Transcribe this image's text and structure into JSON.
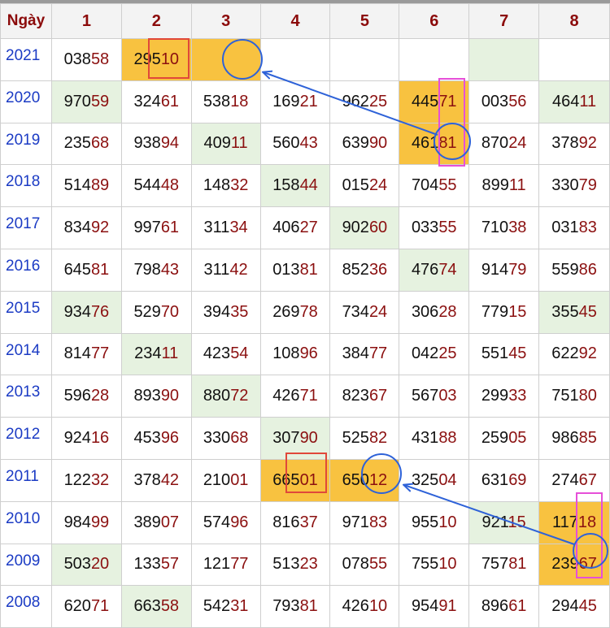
{
  "header": {
    "corner_label": "Ngày",
    "columns": [
      "1",
      "2",
      "3",
      "4",
      "5",
      "6",
      "7",
      "8"
    ]
  },
  "rows": [
    {
      "year": "2021",
      "cells": [
        {
          "head": "038",
          "tail": "58",
          "bg": ""
        },
        {
          "head": "295",
          "tail": "10",
          "bg": "y"
        },
        {
          "head": "",
          "tail": "",
          "bg": "y"
        },
        {
          "head": "",
          "tail": "",
          "bg": ""
        },
        {
          "head": "",
          "tail": "",
          "bg": ""
        },
        {
          "head": "",
          "tail": "",
          "bg": ""
        },
        {
          "head": "",
          "tail": "",
          "bg": "g"
        },
        {
          "head": "",
          "tail": "",
          "bg": ""
        }
      ]
    },
    {
      "year": "2020",
      "cells": [
        {
          "head": "970",
          "tail": "59",
          "bg": "g"
        },
        {
          "head": "324",
          "tail": "61",
          "bg": ""
        },
        {
          "head": "538",
          "tail": "18",
          "bg": ""
        },
        {
          "head": "169",
          "tail": "21",
          "bg": ""
        },
        {
          "head": "962",
          "tail": "25",
          "bg": ""
        },
        {
          "head": "445",
          "tail": "71",
          "bg": "y"
        },
        {
          "head": "003",
          "tail": "56",
          "bg": ""
        },
        {
          "head": "464",
          "tail": "11",
          "bg": "g"
        }
      ]
    },
    {
      "year": "2019",
      "cells": [
        {
          "head": "235",
          "tail": "68",
          "bg": ""
        },
        {
          "head": "938",
          "tail": "94",
          "bg": ""
        },
        {
          "head": "409",
          "tail": "11",
          "bg": "g"
        },
        {
          "head": "560",
          "tail": "43",
          "bg": ""
        },
        {
          "head": "639",
          "tail": "90",
          "bg": ""
        },
        {
          "head": "461",
          "tail": "81",
          "bg": "y"
        },
        {
          "head": "870",
          "tail": "24",
          "bg": ""
        },
        {
          "head": "378",
          "tail": "92",
          "bg": ""
        }
      ]
    },
    {
      "year": "2018",
      "cells": [
        {
          "head": "514",
          "tail": "89",
          "bg": ""
        },
        {
          "head": "544",
          "tail": "48",
          "bg": ""
        },
        {
          "head": "148",
          "tail": "32",
          "bg": ""
        },
        {
          "head": "158",
          "tail": "44",
          "bg": "g"
        },
        {
          "head": "015",
          "tail": "24",
          "bg": ""
        },
        {
          "head": "704",
          "tail": "55",
          "bg": ""
        },
        {
          "head": "899",
          "tail": "11",
          "bg": ""
        },
        {
          "head": "330",
          "tail": "79",
          "bg": ""
        }
      ]
    },
    {
      "year": "2017",
      "cells": [
        {
          "head": "834",
          "tail": "92",
          "bg": ""
        },
        {
          "head": "997",
          "tail": "61",
          "bg": ""
        },
        {
          "head": "311",
          "tail": "34",
          "bg": ""
        },
        {
          "head": "406",
          "tail": "27",
          "bg": ""
        },
        {
          "head": "902",
          "tail": "60",
          "bg": "g"
        },
        {
          "head": "033",
          "tail": "55",
          "bg": ""
        },
        {
          "head": "710",
          "tail": "38",
          "bg": ""
        },
        {
          "head": "031",
          "tail": "83",
          "bg": ""
        }
      ]
    },
    {
      "year": "2016",
      "cells": [
        {
          "head": "645",
          "tail": "81",
          "bg": ""
        },
        {
          "head": "798",
          "tail": "43",
          "bg": ""
        },
        {
          "head": "311",
          "tail": "42",
          "bg": ""
        },
        {
          "head": "013",
          "tail": "81",
          "bg": ""
        },
        {
          "head": "852",
          "tail": "36",
          "bg": ""
        },
        {
          "head": "476",
          "tail": "74",
          "bg": "g"
        },
        {
          "head": "914",
          "tail": "79",
          "bg": ""
        },
        {
          "head": "559",
          "tail": "86",
          "bg": ""
        }
      ]
    },
    {
      "year": "2015",
      "cells": [
        {
          "head": "934",
          "tail": "76",
          "bg": "g"
        },
        {
          "head": "529",
          "tail": "70",
          "bg": ""
        },
        {
          "head": "394",
          "tail": "35",
          "bg": ""
        },
        {
          "head": "269",
          "tail": "78",
          "bg": ""
        },
        {
          "head": "734",
          "tail": "24",
          "bg": ""
        },
        {
          "head": "306",
          "tail": "28",
          "bg": ""
        },
        {
          "head": "779",
          "tail": "15",
          "bg": ""
        },
        {
          "head": "355",
          "tail": "45",
          "bg": "g"
        }
      ]
    },
    {
      "year": "2014",
      "cells": [
        {
          "head": "814",
          "tail": "77",
          "bg": ""
        },
        {
          "head": "234",
          "tail": "11",
          "bg": "g"
        },
        {
          "head": "423",
          "tail": "54",
          "bg": ""
        },
        {
          "head": "108",
          "tail": "96",
          "bg": ""
        },
        {
          "head": "384",
          "tail": "77",
          "bg": ""
        },
        {
          "head": "042",
          "tail": "25",
          "bg": ""
        },
        {
          "head": "551",
          "tail": "45",
          "bg": ""
        },
        {
          "head": "622",
          "tail": "92",
          "bg": ""
        }
      ]
    },
    {
      "year": "2013",
      "cells": [
        {
          "head": "596",
          "tail": "28",
          "bg": ""
        },
        {
          "head": "893",
          "tail": "90",
          "bg": ""
        },
        {
          "head": "880",
          "tail": "72",
          "bg": "g"
        },
        {
          "head": "426",
          "tail": "71",
          "bg": ""
        },
        {
          "head": "823",
          "tail": "67",
          "bg": ""
        },
        {
          "head": "567",
          "tail": "03",
          "bg": ""
        },
        {
          "head": "299",
          "tail": "33",
          "bg": ""
        },
        {
          "head": "751",
          "tail": "80",
          "bg": ""
        }
      ]
    },
    {
      "year": "2012",
      "cells": [
        {
          "head": "924",
          "tail": "16",
          "bg": ""
        },
        {
          "head": "453",
          "tail": "96",
          "bg": ""
        },
        {
          "head": "330",
          "tail": "68",
          "bg": ""
        },
        {
          "head": "307",
          "tail": "90",
          "bg": "g"
        },
        {
          "head": "525",
          "tail": "82",
          "bg": ""
        },
        {
          "head": "431",
          "tail": "88",
          "bg": ""
        },
        {
          "head": "259",
          "tail": "05",
          "bg": ""
        },
        {
          "head": "986",
          "tail": "85",
          "bg": ""
        }
      ]
    },
    {
      "year": "2011",
      "cells": [
        {
          "head": "122",
          "tail": "32",
          "bg": ""
        },
        {
          "head": "378",
          "tail": "42",
          "bg": ""
        },
        {
          "head": "210",
          "tail": "01",
          "bg": ""
        },
        {
          "head": "665",
          "tail": "01",
          "bg": "y"
        },
        {
          "head": "650",
          "tail": "12",
          "bg": "y"
        },
        {
          "head": "325",
          "tail": "04",
          "bg": ""
        },
        {
          "head": "631",
          "tail": "69",
          "bg": ""
        },
        {
          "head": "274",
          "tail": "67",
          "bg": ""
        }
      ]
    },
    {
      "year": "2010",
      "cells": [
        {
          "head": "984",
          "tail": "99",
          "bg": ""
        },
        {
          "head": "389",
          "tail": "07",
          "bg": ""
        },
        {
          "head": "574",
          "tail": "96",
          "bg": ""
        },
        {
          "head": "816",
          "tail": "37",
          "bg": ""
        },
        {
          "head": "971",
          "tail": "83",
          "bg": ""
        },
        {
          "head": "955",
          "tail": "10",
          "bg": ""
        },
        {
          "head": "921",
          "tail": "15",
          "bg": "g"
        },
        {
          "head": "117",
          "tail": "18",
          "bg": "y"
        }
      ]
    },
    {
      "year": "2009",
      "cells": [
        {
          "head": "503",
          "tail": "20",
          "bg": "g"
        },
        {
          "head": "133",
          "tail": "57",
          "bg": ""
        },
        {
          "head": "121",
          "tail": "77",
          "bg": ""
        },
        {
          "head": "513",
          "tail": "23",
          "bg": ""
        },
        {
          "head": "078",
          "tail": "55",
          "bg": ""
        },
        {
          "head": "755",
          "tail": "10",
          "bg": ""
        },
        {
          "head": "757",
          "tail": "81",
          "bg": ""
        },
        {
          "head": "239",
          "tail": "67",
          "bg": "y"
        }
      ]
    },
    {
      "year": "2008",
      "cells": [
        {
          "head": "620",
          "tail": "71",
          "bg": ""
        },
        {
          "head": "663",
          "tail": "58",
          "bg": "g"
        },
        {
          "head": "542",
          "tail": "31",
          "bg": ""
        },
        {
          "head": "793",
          "tail": "81",
          "bg": ""
        },
        {
          "head": "426",
          "tail": "10",
          "bg": ""
        },
        {
          "head": "954",
          "tail": "91",
          "bg": ""
        },
        {
          "head": "896",
          "tail": "61",
          "bg": ""
        },
        {
          "head": "294",
          "tail": "45",
          "bg": ""
        }
      ]
    }
  ],
  "colors": {
    "header_text": "#8b0a0a",
    "year_text": "#1b3bc4",
    "tail_text": "#8b1010",
    "green_highlight": "#e6f2e0",
    "yellow_highlight": "#f8c240",
    "annotation_blue": "#2e62d8",
    "annotation_red": "#e0483a",
    "annotation_pink": "#e64fd8"
  }
}
